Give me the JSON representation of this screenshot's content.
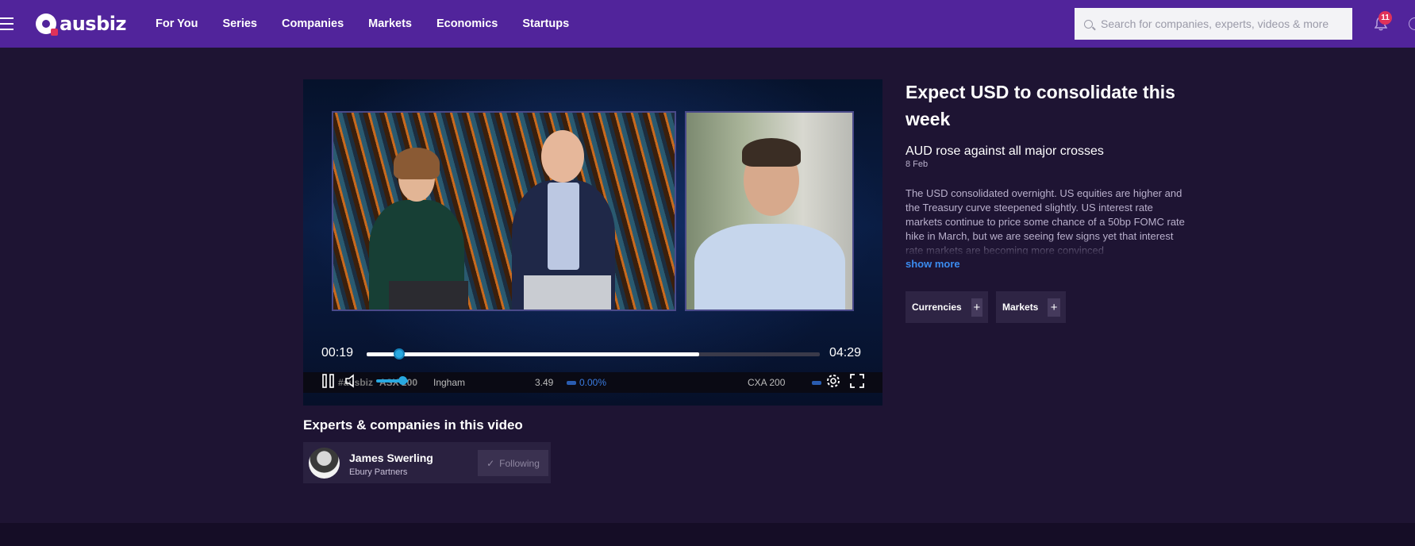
{
  "header": {
    "logo_text": "ausbiz",
    "nav": [
      "For You",
      "Series",
      "Companies",
      "Markets",
      "Economics",
      "Startups"
    ],
    "search_placeholder": "Search for companies, experts, videos & more",
    "notifications_count": "11"
  },
  "player": {
    "current_time": "00:19",
    "duration": "04:29",
    "progress_fraction": 0.071,
    "buffered_fraction": 0.733,
    "ticker": {
      "brand": "#ausbiz",
      "index_left": "ASX 200",
      "company": "Ingham",
      "price": "3.49",
      "change": "0.00%",
      "index_right": "CXA 200"
    }
  },
  "article": {
    "title": "Expect USD to consolidate this week",
    "subtitle": "AUD rose against all major crosses",
    "date": "8 Feb",
    "description": "The USD consolidated overnight. US equities are higher and the Treasury curve steepened slightly. US interest rate markets continue to price some chance of a 50bp FOMC rate hike in March, but we are seeing few signs yet that interest rate markets are becoming more convinced",
    "show_more": "show more",
    "tags": [
      "Currencies",
      "Markets"
    ]
  },
  "experts": {
    "heading": "Experts & companies in this video",
    "items": [
      {
        "name": "James Swerling",
        "company": "Ebury Partners",
        "follow_label": "Following"
      }
    ]
  },
  "colors": {
    "nav_bg": "#51249b",
    "page_bg": "#1e1433",
    "accent_link": "#3b8cf0",
    "progress_thumb": "#28a8e0",
    "badge": "#e0325a"
  }
}
